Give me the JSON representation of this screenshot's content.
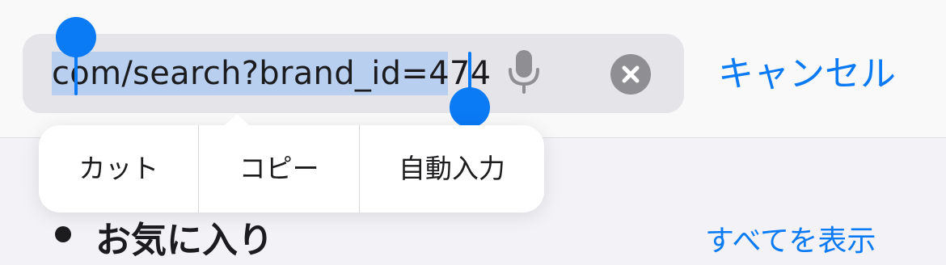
{
  "search_bar": {
    "url_value": "com/search?brand_id=474",
    "mic_icon": "microphone-icon",
    "clear_icon": "clear-x-icon",
    "cancel_label": "キャンセル"
  },
  "edit_menu": {
    "items": [
      {
        "label": "カット"
      },
      {
        "label": "コピー"
      },
      {
        "label": "自動入力"
      }
    ]
  },
  "favorites": {
    "icon": "person-icon",
    "title": "お気に入り",
    "show_all_label": "すべてを表示"
  },
  "colors": {
    "accent": "#0a7af5",
    "selection": "#b8cff0",
    "field_bg": "#e4e4e9",
    "clear_bg": "#8e8e93"
  }
}
